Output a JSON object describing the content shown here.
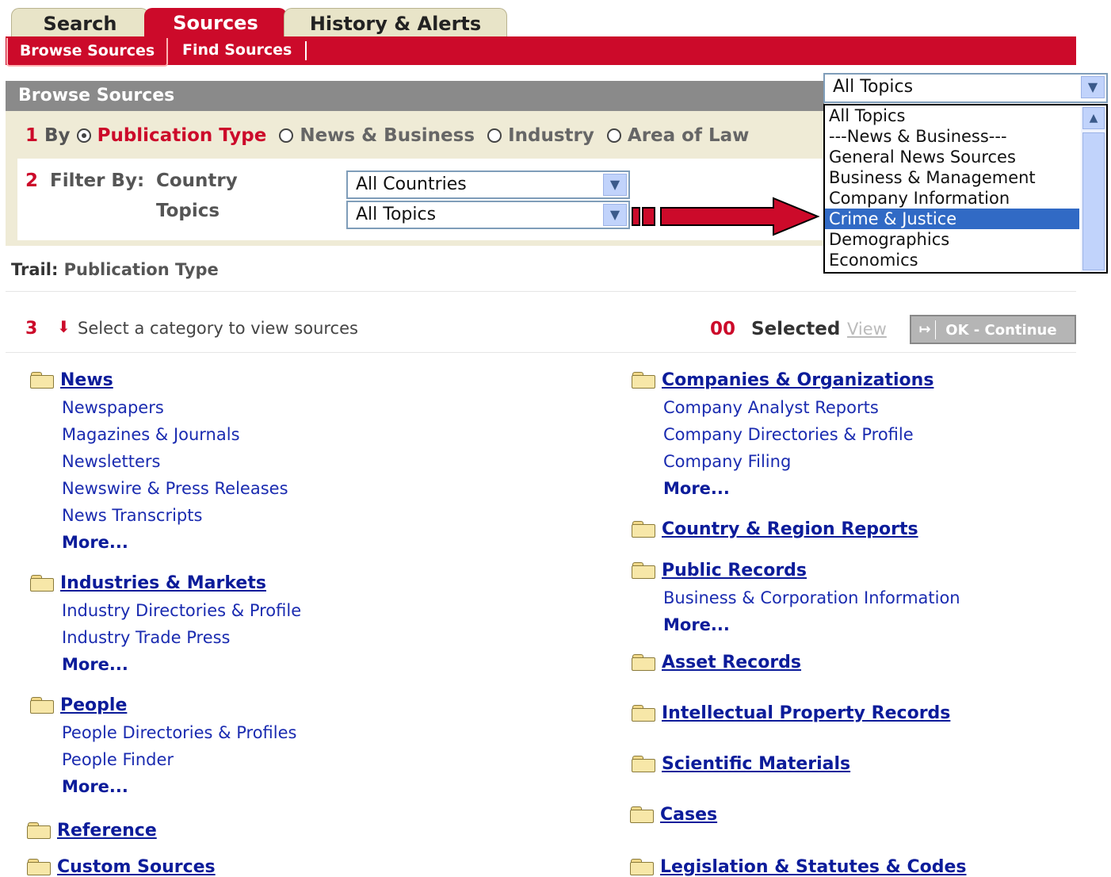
{
  "tabs": [
    {
      "label": "Search"
    },
    {
      "label": "Sources"
    },
    {
      "label": "History & Alerts"
    }
  ],
  "subtabs": [
    {
      "label": "Browse Sources"
    },
    {
      "label": "Find Sources"
    }
  ],
  "header": {
    "title": "Browse Sources"
  },
  "step1": {
    "number": "1",
    "label": "By",
    "options": [
      "Publication Type",
      "News & Business",
      "Industry",
      "Area of Law"
    ],
    "selected": "Publication Type"
  },
  "step2": {
    "number": "2",
    "label": "Filter By:",
    "country_label": "Country",
    "topics_label": "Topics",
    "country_value": "All Countries",
    "topics_value": "All Topics"
  },
  "topics_dropdown": {
    "value": "All Topics",
    "options": [
      "All Topics",
      "---News & Business---",
      "General News Sources",
      "Business & Management",
      "Company Information",
      "Crime & Justice",
      "Demographics",
      "Economics"
    ],
    "highlighted": "Crime & Justice"
  },
  "trail": {
    "label": "Trail:",
    "value": "Publication Type"
  },
  "step3": {
    "number": "3",
    "instruction": "Select a category to view sources",
    "selected_count": "00",
    "selected_label": "Selected",
    "view_label": "View",
    "ok_label": "OK - Continue"
  },
  "categories_left": [
    {
      "name": "News",
      "items": [
        "Newspapers",
        "Magazines & Journals",
        "Newsletters",
        "Newswire & Press Releases",
        "News Transcripts"
      ],
      "more": "More..."
    },
    {
      "name": "Industries & Markets",
      "items": [
        "Industry Directories & Profile",
        "Industry Trade Press"
      ],
      "more": "More..."
    },
    {
      "name": "People",
      "items": [
        "People Directories & Profiles",
        "People Finder"
      ],
      "more": "More..."
    },
    {
      "name": "Reference",
      "items": [],
      "more": ""
    },
    {
      "name": "Custom Sources",
      "items": [],
      "more": ""
    }
  ],
  "categories_right": [
    {
      "name": "Companies & Organizations",
      "items": [
        "Company Analyst Reports",
        "Company Directories & Profile",
        "Company Filing"
      ],
      "more": "More..."
    },
    {
      "name": "Country & Region Reports",
      "items": [],
      "more": ""
    },
    {
      "name": "Public Records",
      "items": [
        "Business & Corporation Information"
      ],
      "more": "More..."
    },
    {
      "name": "Asset Records",
      "items": [],
      "more": ""
    },
    {
      "name": "Intellectual Property Records",
      "items": [],
      "more": ""
    },
    {
      "name": "Scientific Materials",
      "items": [],
      "more": ""
    },
    {
      "name": "Cases",
      "items": [],
      "more": ""
    },
    {
      "name": "Legislation & Statutes & Codes",
      "items": [],
      "more": ""
    }
  ],
  "colors": {
    "brand_red": "#cc0a2a",
    "link_blue": "#0c1c9a",
    "highlight": "#316ac5"
  }
}
